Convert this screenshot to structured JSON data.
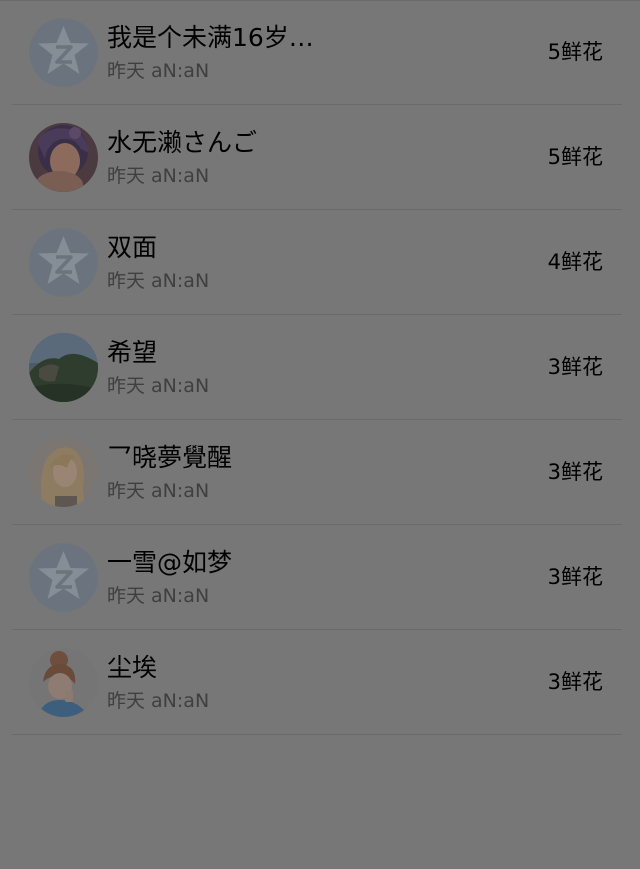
{
  "rank_list": {
    "items": [
      {
        "name": "我是个未满16岁…",
        "time": "昨天 aN:aN",
        "flowers": "5鲜花",
        "avatar_icon": "qzone-default-star-icon"
      },
      {
        "name": "水无濑さんご",
        "time": "昨天 aN:aN",
        "flowers": "5鲜花",
        "avatar_icon": "user-photo"
      },
      {
        "name": "双面",
        "time": "昨天 aN:aN",
        "flowers": "4鲜花",
        "avatar_icon": "qzone-default-star-icon"
      },
      {
        "name": "希望",
        "time": "昨天 aN:aN",
        "flowers": "3鲜花",
        "avatar_icon": "user-photo"
      },
      {
        "name": "乛晓夢覺醒",
        "time": "昨天 aN:aN",
        "flowers": "3鲜花",
        "avatar_icon": "user-photo"
      },
      {
        "name": "一雪@如梦",
        "time": "昨天 aN:aN",
        "flowers": "3鲜花",
        "avatar_icon": "qzone-default-star-icon"
      },
      {
        "name": "尘埃",
        "time": "昨天 aN:aN",
        "flowers": "3鲜花",
        "avatar_icon": "user-photo"
      }
    ]
  },
  "colors": {
    "overlay_background": "#777777",
    "default_avatar": "#6b747e",
    "divider": "#6a6a6a"
  }
}
